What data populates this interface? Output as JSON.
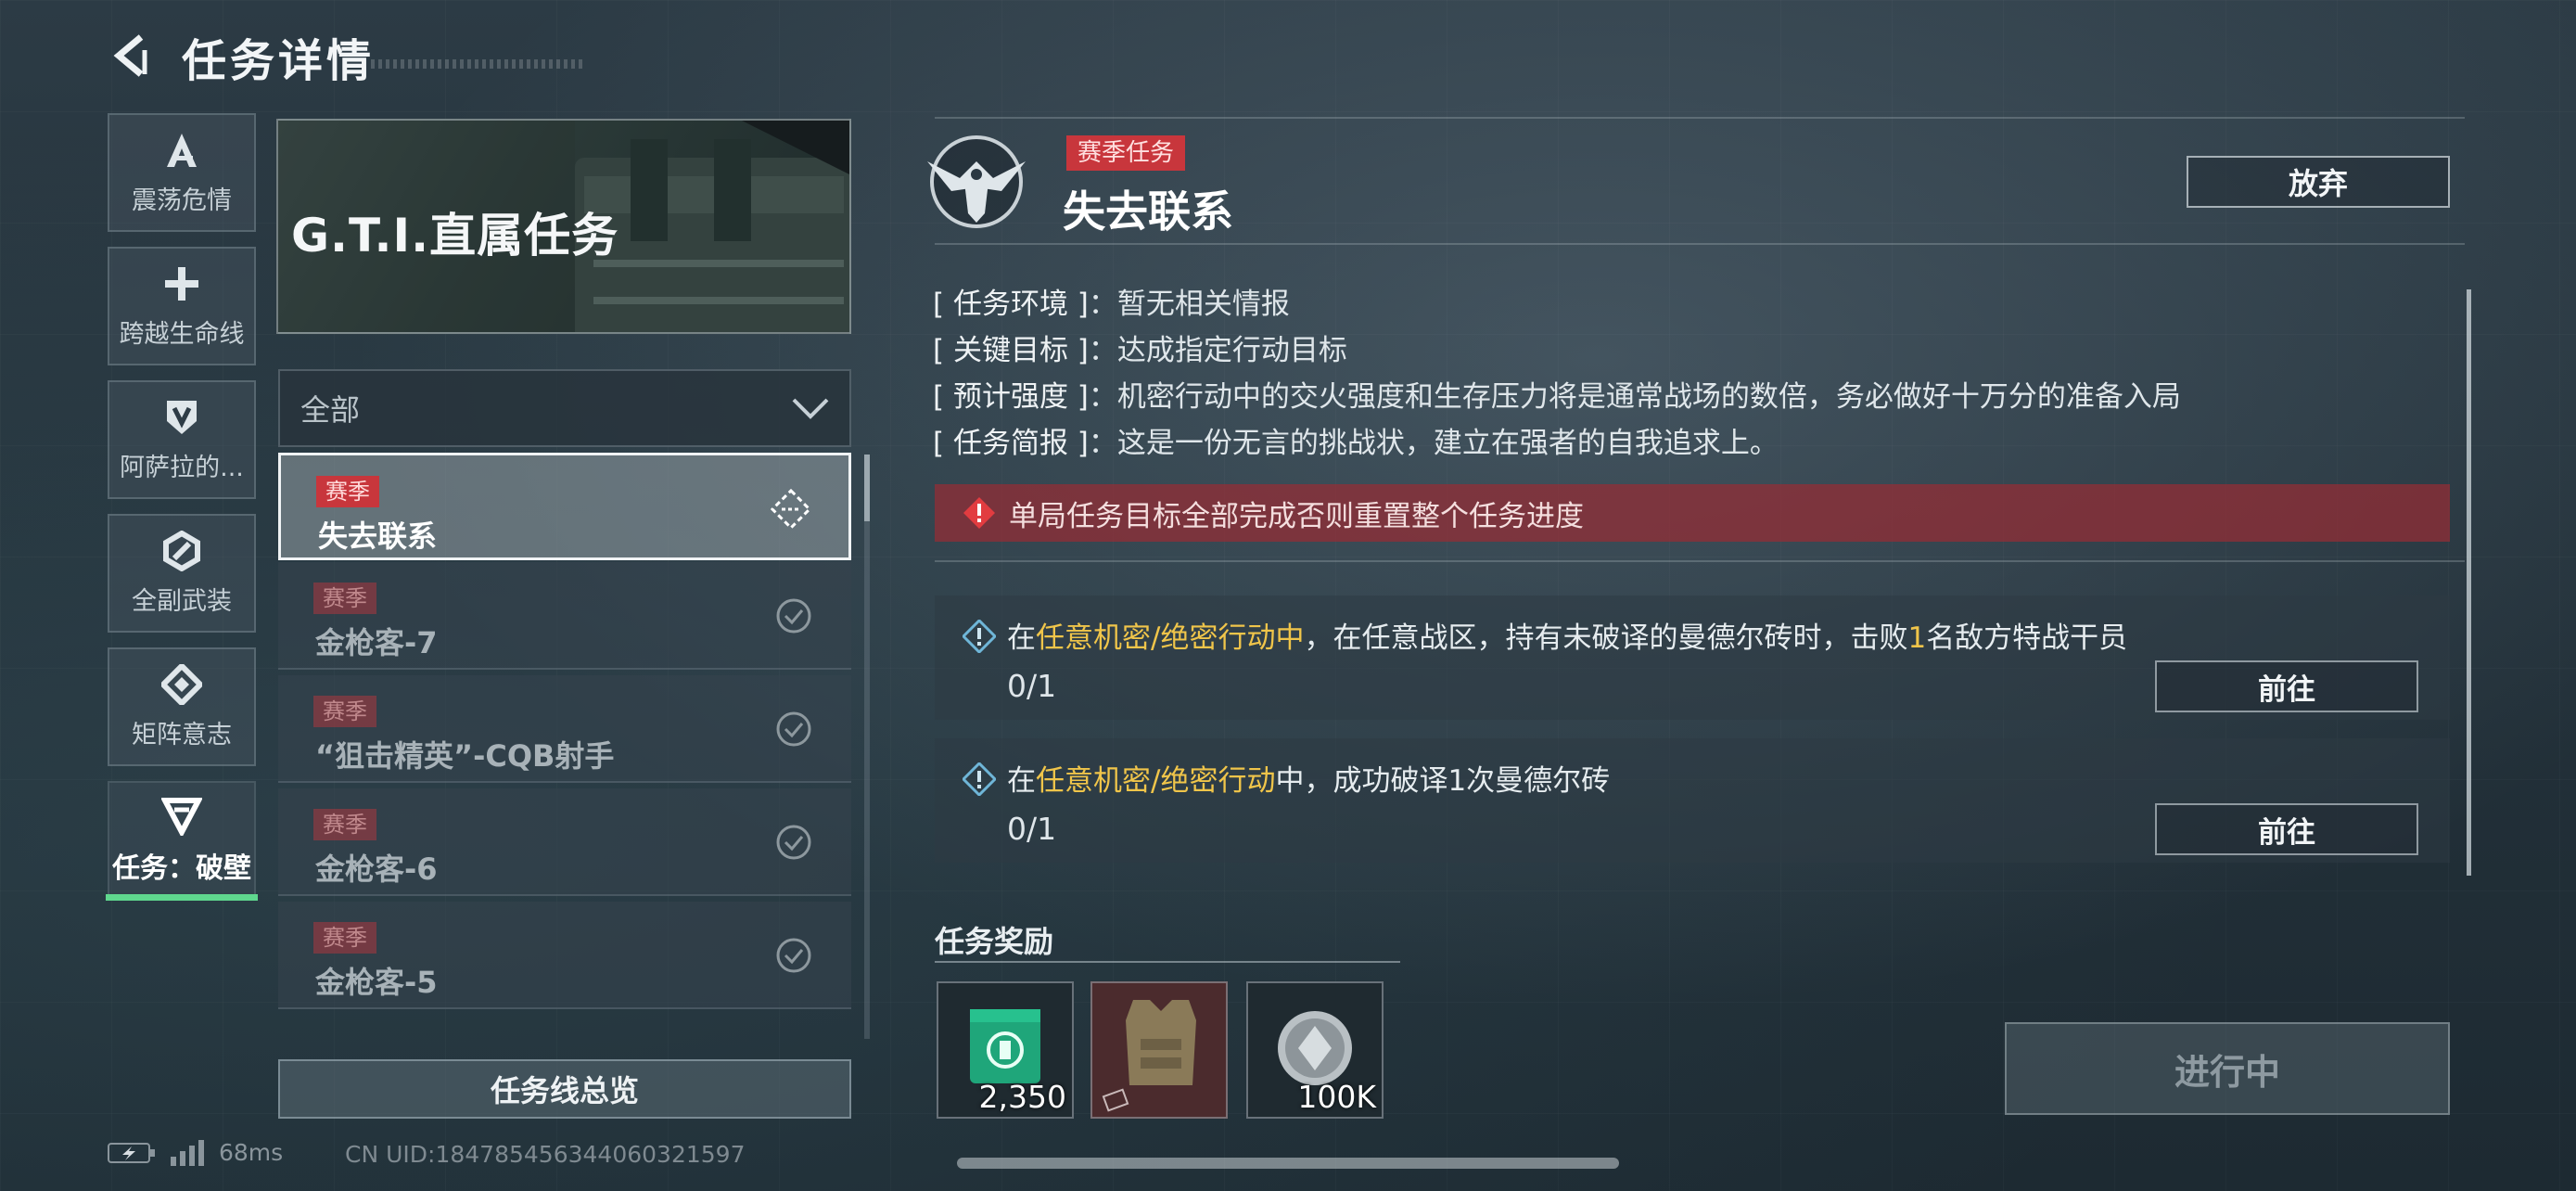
{
  "header": {
    "title": "任务详情"
  },
  "nav": [
    {
      "label": "震荡危情",
      "icon": "a-shape-icon"
    },
    {
      "label": "跨越生命线",
      "icon": "plus-icon"
    },
    {
      "label": "阿萨拉的...",
      "icon": "shield-v-icon"
    },
    {
      "label": "全副武装",
      "icon": "hex-slash-icon"
    },
    {
      "label": "矩阵意志",
      "icon": "diamond-icon"
    },
    {
      "label": "任务：破壁",
      "icon": "triangle-icon",
      "active": true
    }
  ],
  "banner": {
    "title": "G.T.I.直属任务"
  },
  "filter": {
    "value": "全部"
  },
  "task_list": [
    {
      "tag": "赛季",
      "name": "失去联系",
      "status": "in-progress",
      "active": true
    },
    {
      "tag": "赛季",
      "name": "金枪客-7",
      "status": "completed"
    },
    {
      "tag": "赛季",
      "name": "“狙击精英”-CQB射手",
      "status": "completed"
    },
    {
      "tag": "赛季",
      "name": "金枪客-6",
      "status": "completed"
    },
    {
      "tag": "赛季",
      "name": "金枪客-5",
      "status": "completed"
    }
  ],
  "overview_button": "任务线总览",
  "status_bar": {
    "ping": "68ms",
    "uid": "CN UID:1847854563440603215​97"
  },
  "detail": {
    "season_tag": "赛季任务",
    "title": "失去联系",
    "abandon": "放弃",
    "info": [
      {
        "key": "[ 任务环境 ]",
        "value": "暂无相关情报"
      },
      {
        "key": "[ 关键目标 ]",
        "value": "达成指定行动目标"
      },
      {
        "key": "[ 预计强度 ]",
        "value": "机密行动中的交火强度和生存压力将是通常战场的数倍，务必做好十万分的准备入局"
      },
      {
        "key": "[ 任务简报 ]",
        "value": "这是一份无言的挑战状，建立在强者的自我追求上。"
      }
    ],
    "warning": "单局任务目标全部完成否则重置整个任务进度",
    "objectives": [
      {
        "t1": "在",
        "h1": "任意机密/绝密行动中",
        "t2": "，在任意战区，持有未破译的曼德尔砖时，击败",
        "h2": "1",
        "t3": "名敌方特战干员",
        "progress": "0/1",
        "button": "前往"
      },
      {
        "t1": "在",
        "h1": "任意机密/绝密行动",
        "t2": "中，成功破译1次曼德尔砖",
        "h2": "",
        "t3": "",
        "progress": "0/1",
        "button": "前往"
      }
    ],
    "reward_title": "任务奖励",
    "rewards": [
      {
        "icon": "green-supply-icon",
        "amount": "2,350"
      },
      {
        "icon": "armor-vest-icon",
        "amount": ""
      },
      {
        "icon": "silver-coin-icon",
        "amount": "100K"
      }
    ],
    "progress_button": "进行中"
  },
  "colors": {
    "accent_green": "#5fd88e",
    "season_red": "#c8363c",
    "highlight_yellow": "#f0c54a"
  }
}
